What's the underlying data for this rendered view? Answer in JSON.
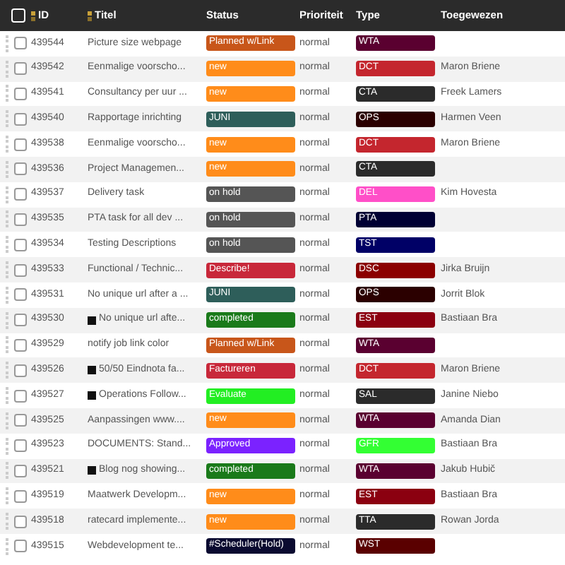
{
  "select_all": {
    "checked": false
  },
  "columns": [
    {
      "label": "ID",
      "sortable": true
    },
    {
      "label": "Titel",
      "sortable": true
    },
    {
      "label": "Status",
      "sortable": false
    },
    {
      "label": "Prioriteit",
      "sortable": false
    },
    {
      "label": "Type",
      "sortable": false
    },
    {
      "label": "Toegewezen",
      "sortable": false
    }
  ],
  "rows": [
    {
      "checked": false,
      "id": "439544",
      "title": "Picture size webpage",
      "icon": false,
      "status": {
        "label": "Planned w/Link",
        "color": "#c8561a"
      },
      "priority": "normal",
      "type": {
        "label": "WTA",
        "color": "#5a0030"
      },
      "assignee": ""
    },
    {
      "checked": false,
      "id": "439542",
      "title": "Eenmalige voorscho...",
      "icon": false,
      "status": {
        "label": "new",
        "color": "#ff8c1a"
      },
      "priority": "normal",
      "type": {
        "label": "DCT",
        "color": "#c4262e"
      },
      "assignee": "Maron Briene"
    },
    {
      "checked": false,
      "id": "439541",
      "title": "Consultancy per uur ...",
      "icon": false,
      "status": {
        "label": "new",
        "color": "#ff8c1a"
      },
      "priority": "normal",
      "type": {
        "label": "CTA",
        "color": "#2b2b2b"
      },
      "assignee": "Freek Lamers"
    },
    {
      "checked": false,
      "id": "439540",
      "title": "Rapportage inrichting",
      "icon": false,
      "status": {
        "label": "JUNI",
        "color": "#2e5e5a"
      },
      "priority": "normal",
      "type": {
        "label": "OPS",
        "color": "#2b0000"
      },
      "assignee": "Harmen Veen"
    },
    {
      "checked": false,
      "id": "439538",
      "title": "Eenmalige voorscho...",
      "icon": false,
      "status": {
        "label": "new",
        "color": "#ff8c1a"
      },
      "priority": "normal",
      "type": {
        "label": "DCT",
        "color": "#c4262e"
      },
      "assignee": "Maron Briene"
    },
    {
      "checked": false,
      "id": "439536",
      "title": "Project Managemen...",
      "icon": false,
      "status": {
        "label": "new",
        "color": "#ff8c1a"
      },
      "priority": "normal",
      "type": {
        "label": "CTA",
        "color": "#2b2b2b"
      },
      "assignee": ""
    },
    {
      "checked": false,
      "id": "439537",
      "title": "Delivery task",
      "icon": false,
      "status": {
        "label": "on hold",
        "color": "#555555"
      },
      "priority": "normal",
      "type": {
        "label": "DEL",
        "color": "#ff4fc8"
      },
      "assignee": "Kim Hovesta"
    },
    {
      "checked": false,
      "id": "439535",
      "title": "PTA task for all dev ...",
      "icon": false,
      "status": {
        "label": "on hold",
        "color": "#555555"
      },
      "priority": "normal",
      "type": {
        "label": "PTA",
        "color": "#000033"
      },
      "assignee": ""
    },
    {
      "checked": false,
      "id": "439534",
      "title": "Testing Descriptions",
      "icon": false,
      "status": {
        "label": "on hold",
        "color": "#555555"
      },
      "priority": "normal",
      "type": {
        "label": "TST",
        "color": "#000066"
      },
      "assignee": ""
    },
    {
      "checked": false,
      "id": "439533",
      "title": "Functional / Technic...",
      "icon": false,
      "status": {
        "label": "Describe!",
        "color": "#c8283a"
      },
      "priority": "normal",
      "type": {
        "label": "DSC",
        "color": "#8b0000"
      },
      "assignee": "Jirka Bruijn"
    },
    {
      "checked": false,
      "id": "439531",
      "title": "No unique url after a ...",
      "icon": false,
      "status": {
        "label": "JUNI",
        "color": "#2e5e5a"
      },
      "priority": "normal",
      "type": {
        "label": "OPS",
        "color": "#2b0000"
      },
      "assignee": "Jorrit Blok"
    },
    {
      "checked": false,
      "id": "439530",
      "title": "No unique url afte...",
      "icon": true,
      "status": {
        "label": "completed",
        "color": "#1a7a1a"
      },
      "priority": "normal",
      "type": {
        "label": "EST",
        "color": "#8b0010"
      },
      "assignee": "Bastiaan Bra"
    },
    {
      "checked": false,
      "id": "439529",
      "title": "notify job link color",
      "icon": false,
      "status": {
        "label": "Planned w/Link",
        "color": "#c8561a"
      },
      "priority": "normal",
      "type": {
        "label": "WTA",
        "color": "#5a0030"
      },
      "assignee": ""
    },
    {
      "checked": false,
      "id": "439526",
      "title": "50/50 Eindnota fa...",
      "icon": true,
      "status": {
        "label": "Factureren",
        "color": "#c8283a"
      },
      "priority": "normal",
      "type": {
        "label": "DCT",
        "color": "#c4262e"
      },
      "assignee": "Maron Briene"
    },
    {
      "checked": false,
      "id": "439527",
      "title": "Operations Follow...",
      "icon": true,
      "status": {
        "label": "Evaluate",
        "color": "#22ee22"
      },
      "priority": "normal",
      "type": {
        "label": "SAL",
        "color": "#2b2b2b"
      },
      "assignee": "Janine Niebo"
    },
    {
      "checked": false,
      "id": "439525",
      "title": "Aanpassingen www....",
      "icon": false,
      "status": {
        "label": "new",
        "color": "#ff8c1a"
      },
      "priority": "normal",
      "type": {
        "label": "WTA",
        "color": "#5a0030"
      },
      "assignee": "Amanda Dian"
    },
    {
      "checked": false,
      "id": "439523",
      "title": "DOCUMENTS: Stand...",
      "icon": false,
      "status": {
        "label": "Approved",
        "color": "#7b22ff"
      },
      "priority": "normal",
      "type": {
        "label": "GFR",
        "color": "#33ff33"
      },
      "assignee": "Bastiaan Bra"
    },
    {
      "checked": false,
      "id": "439521",
      "title": "Blog nog showing...",
      "icon": true,
      "status": {
        "label": "completed",
        "color": "#1a7a1a"
      },
      "priority": "normal",
      "type": {
        "label": "WTA",
        "color": "#5a0030"
      },
      "assignee": "Jakub Hubič"
    },
    {
      "checked": false,
      "id": "439519",
      "title": "Maatwerk Developm...",
      "icon": false,
      "status": {
        "label": "new",
        "color": "#ff8c1a"
      },
      "priority": "normal",
      "type": {
        "label": "EST",
        "color": "#8b0010"
      },
      "assignee": "Bastiaan Bra"
    },
    {
      "checked": false,
      "id": "439518",
      "title": "ratecard implemente...",
      "icon": false,
      "status": {
        "label": "new",
        "color": "#ff8c1a"
      },
      "priority": "normal",
      "type": {
        "label": "TTA",
        "color": "#2b2b2b"
      },
      "assignee": "Rowan Jorda"
    },
    {
      "checked": false,
      "id": "439515",
      "title": "Webdevelopment te...",
      "icon": false,
      "status": {
        "label": "#Scheduler(Hold)",
        "color": "#0a0a30"
      },
      "priority": "normal",
      "type": {
        "label": "WST",
        "color": "#5a0000"
      },
      "assignee": ""
    }
  ]
}
